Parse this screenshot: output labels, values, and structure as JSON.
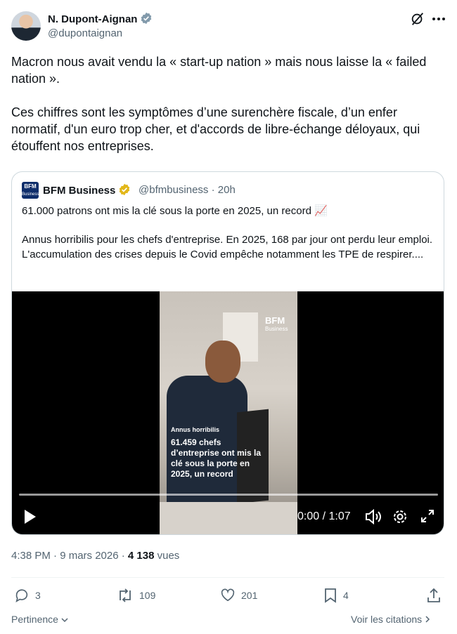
{
  "author": {
    "name": "N. Dupont-Aignan",
    "handle": "@dupontaignan"
  },
  "tweet": {
    "paragraph1": "Macron nous avait vendu la « start-up nation » mais nous laisse la « failed nation ».",
    "paragraph2": "Ces chiffres sont les symptômes d’une surenchère fiscale, d’un enfer normatif, d'un euro trop cher, et d'accords de libre-échange déloyaux, qui étouffent nos entreprises."
  },
  "quote": {
    "logo_text": "BFM",
    "logo_sub": "Business",
    "name": "BFM Business",
    "handle_time": "@bfmbusiness · 20h",
    "title": "61.000 patrons ont mis la clé sous la porte en 2025, un record 📈",
    "body": "Annus horribilis pour les chefs d'entreprise. En 2025, 168 par jour ont perdu leur emploi. L'accumulation des crises depuis le Covid empêche notamment les TPE de respirer....",
    "video": {
      "watermark": "BFM",
      "watermark_sub": "Business",
      "overlay_small": "Annus horribilis",
      "overlay_big": "61.459 chefs d’entreprise ont mis la clé sous la porte en 2025, un record",
      "timecode": "0:00 / 1:07",
      "progress": 0
    }
  },
  "meta": {
    "time_date": "4:38 PM · 9 mars 2026 · ",
    "views_count": "4 138",
    "views_label": " vues"
  },
  "actions": {
    "replies": "3",
    "reposts": "109",
    "likes": "201",
    "bookmarks": "4"
  },
  "footer": {
    "sort_label": "Pertinence",
    "quotes_link": "Voir les citations"
  },
  "colors": {
    "verified_blue": "#1d9bf0",
    "verified_gold": "#e2b719",
    "trend_red": "#e0245e"
  }
}
